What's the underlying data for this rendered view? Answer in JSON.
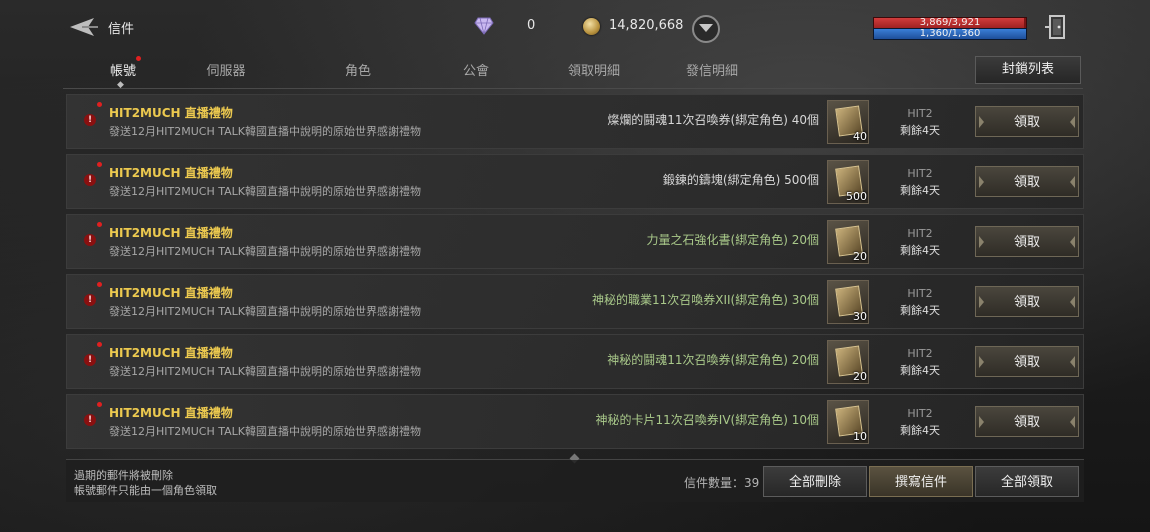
{
  "header": {
    "title": "信件",
    "diamonds": "0",
    "gold": "14,820,668",
    "hp_text": "3,869/3,921",
    "hp_fraction": 0.987,
    "mp_text": "1,360/1,360",
    "mp_fraction": 1.0
  },
  "tabs": [
    {
      "label": "帳號"
    },
    {
      "label": "伺服器"
    },
    {
      "label": "角色"
    },
    {
      "label": "公會"
    },
    {
      "label": "領取明細"
    },
    {
      "label": "發信明細"
    }
  ],
  "block_list_label": "封鎖列表",
  "mails": [
    {
      "title": "HIT2MUCH 直播禮物",
      "desc": "發送12月HIT2MUCH TALK韓國直播中說明的原始世界感謝禮物",
      "item": "燦爛的鬪魂11次召喚券(綁定角色) 40個",
      "item_color": "#d8d8d8",
      "qty": "40",
      "sender": "HIT2",
      "remaining": "剩餘4天",
      "claim": "領取"
    },
    {
      "title": "HIT2MUCH 直播禮物",
      "desc": "發送12月HIT2MUCH TALK韓國直播中說明的原始世界感謝禮物",
      "item": "鍛鍊的鑄塊(綁定角色) 500個",
      "item_color": "#d8d8d8",
      "qty": "500",
      "sender": "HIT2",
      "remaining": "剩餘4天",
      "claim": "領取"
    },
    {
      "title": "HIT2MUCH 直播禮物",
      "desc": "發送12月HIT2MUCH TALK韓國直播中說明的原始世界感謝禮物",
      "item": "力量之石強化書(綁定角色) 20個",
      "item_color": "#a9c98a",
      "qty": "20",
      "sender": "HIT2",
      "remaining": "剩餘4天",
      "claim": "領取"
    },
    {
      "title": "HIT2MUCH 直播禮物",
      "desc": "發送12月HIT2MUCH TALK韓國直播中說明的原始世界感謝禮物",
      "item": "神秘的職業11次召喚券XII(綁定角色) 30個",
      "item_color": "#a9c98a",
      "qty": "30",
      "sender": "HIT2",
      "remaining": "剩餘4天",
      "claim": "領取"
    },
    {
      "title": "HIT2MUCH 直播禮物",
      "desc": "發送12月HIT2MUCH TALK韓國直播中說明的原始世界感謝禮物",
      "item": "神秘的鬪魂11次召喚券(綁定角色) 20個",
      "item_color": "#a9c98a",
      "qty": "20",
      "sender": "HIT2",
      "remaining": "剩餘4天",
      "claim": "領取"
    },
    {
      "title": "HIT2MUCH 直播禮物",
      "desc": "發送12月HIT2MUCH TALK韓國直播中說明的原始世界感謝禮物",
      "item": "神秘的卡片11次召喚券IV(綁定角色) 10個",
      "item_color": "#a9c98a",
      "qty": "10",
      "sender": "HIT2",
      "remaining": "剩餘4天",
      "claim": "領取"
    }
  ],
  "footer": {
    "note1": "過期的郵件將被刪除",
    "note2": "帳號郵件只能由一個角色領取",
    "mail_count": "信件數量：39",
    "delete_all": "全部刪除",
    "compose": "撰寫信件",
    "claim_all": "全部領取"
  }
}
